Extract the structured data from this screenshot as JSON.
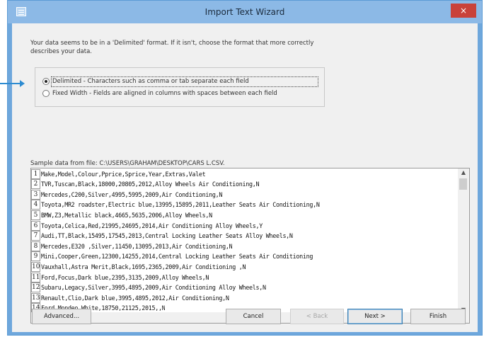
{
  "window": {
    "title": "Import Text Wizard",
    "close_glyph": "×",
    "icon": "text-file-icon"
  },
  "intro_text": "Your data seems to be in a 'Delimited' format. If it isn't, choose the format that more correctly describes your data.",
  "format_options": [
    {
      "label": "Delimited - Characters such as comma or tab separate each field",
      "selected": true
    },
    {
      "label": "Fixed Width - Fields are aligned in columns with spaces between each field",
      "selected": false
    }
  ],
  "sample_label": "Sample data from file: C:\\USERS\\GRAHAM\\DESKTOP\\CARS L.CSV.",
  "rows": [
    {
      "num": "1",
      "text": "Make,Model,Colour,Pprice,Sprice,Year,Extras,Valet"
    },
    {
      "num": "2",
      "text": "TVR,Tuscan,Black,18000,20805,2012,Alloy Wheels   Air Conditioning,N"
    },
    {
      "num": "3",
      "text": "Mercedes,C200,Silver,4995,5995,2009,Air Conditioning,N"
    },
    {
      "num": "4",
      "text": "Toyota,MR2 roadster,Electric blue,13995,15895,2011,Leather Seats   Air Conditioning,N"
    },
    {
      "num": "5",
      "text": "BMW,Z3,Metallic black,4665,5635,2006,Alloy Wheels,N"
    },
    {
      "num": "6",
      "text": "Toyota,Celica,Red,21995,24695,2014,Air Conditioning   Alloy Wheels,Y"
    },
    {
      "num": "7",
      "text": "Audi,TT,Black,15495,17545,2013,Central Locking   Leather Seats   Alloy Wheels,N"
    },
    {
      "num": "8",
      "text": "Mercedes,E320 ,Silver,11450,13095,2013,Air Conditioning,N"
    },
    {
      "num": "9",
      "text": "Mini,Cooper,Green,12300,14255,2014,Central Locking   Leather Seats   Air Conditioning"
    },
    {
      "num": "10",
      "text": "Vauxhall,Astra Merit,Black,1695,2365,2009,Air Conditioning ,N"
    },
    {
      "num": "11",
      "text": "Ford,Focus,Dark blue,2395,3135,2009,Alloy Wheels,N"
    },
    {
      "num": "12",
      "text": "Subaru,Legacy,Silver,3995,4895,2009,Air Conditioning   Alloy Wheels,N"
    },
    {
      "num": "13",
      "text": "Renault,Clio,Dark blue,3995,4895,2012,Air Conditioning,N"
    },
    {
      "num": "14",
      "text": "Ford,Mondeo,White,18750,21125,2015,,N"
    }
  ],
  "scroll_arrows": {
    "up": "▲",
    "down": "▼",
    "left": "◀",
    "right": "▶"
  },
  "buttons": {
    "advanced": "Advanced...",
    "cancel": "Cancel",
    "back": "< Back",
    "next": "Next >",
    "finish": "Finish"
  },
  "colors": {
    "titlebar": "#8cb9e6",
    "close": "#c9423a",
    "pointer": "#2d8bd1"
  }
}
